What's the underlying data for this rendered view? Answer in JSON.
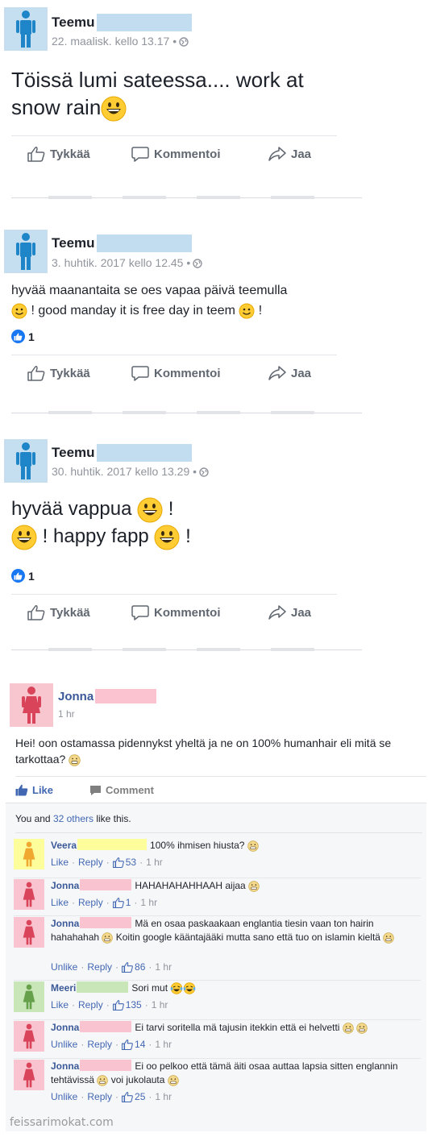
{
  "posts": [
    {
      "author": "Teemu",
      "meta": "22. maalisk. kello 13.17 •",
      "text_line1": "Töissä lumi sateessa.... work at",
      "text_line2": "snow rain",
      "reactions": "",
      "like_label": "Tykkää",
      "comment_label": "Kommentoi",
      "share_label": "Jaa"
    },
    {
      "author": "Teemu",
      "meta": "3. huhtik. 2017 kello 12.45 •",
      "text_line1": "hyvää maanantaita se oes vapaa päivä teemulla",
      "text_line2a": " ! good manday it is free day in teem ",
      "text_line2b": " !",
      "reactions": "1",
      "like_label": "Tykkää",
      "comment_label": "Kommentoi",
      "share_label": "Jaa"
    },
    {
      "author": "Teemu",
      "meta": "30. huhtik. 2017 kello 13.29 •",
      "text_line1a": "hyvää vappua ",
      "text_line1b": " !",
      "text_line2a": " ! happy fapp ",
      "text_line2b": " !",
      "reactions": "1",
      "like_label": "Tykkää",
      "comment_label": "Kommentoi",
      "share_label": "Jaa"
    }
  ],
  "jonna_post": {
    "author": "Jonna",
    "time": "1 hr",
    "text": "Hei! oon ostamassa pidennykst yheltä ja ne on 100% humanhair eli mitä se tarkottaa?",
    "like_label": "Like",
    "comment_label": "Comment",
    "likes_prefix": "You and ",
    "likes_link": "32 others",
    "likes_suffix": " like this."
  },
  "comments": [
    {
      "name": "Veera",
      "text": "100% ihmisen hiusta?",
      "like": "Like",
      "reply": "Reply",
      "count": "53",
      "time": "1 hr",
      "color": "#f0a830",
      "redact": "#fdfd9c"
    },
    {
      "name": "Jonna",
      "text": "HAHAHAHAHHAAH aijaa",
      "like": "Like",
      "reply": "Reply",
      "count": "1",
      "time": "1 hr",
      "color": "#d9445a",
      "redact": "#f9c4cf"
    },
    {
      "name": "Jonna",
      "text": "Mä en osaa paskaakaan englantia tiesin vaan ton hairin hahahahah",
      "text2": " Koitin google kääntajääki mutta sano että tuo on islamin kieltä",
      "like": "Unlike",
      "reply": "Reply",
      "count": "86",
      "time": "1 hr",
      "color": "#d9445a",
      "redact": "#f9c4cf"
    },
    {
      "name": "Meeri",
      "text": "Sori mut",
      "like": "Like",
      "reply": "Reply",
      "count": "135",
      "time": "1 hr",
      "color": "#66a04a",
      "redact": "#c8e6b8"
    },
    {
      "name": "Jonna",
      "text": "Ei tarvi soritella mä tajusin itekkin että ei helvetti",
      "like": "Unlike",
      "reply": "Reply",
      "count": "14",
      "time": "1 hr",
      "color": "#d9445a",
      "redact": "#f9c4cf"
    },
    {
      "name": "Jonna",
      "text": "Ei oo pelkoo että tämä äiti osaa auttaa lapsia sitten englannin tehtävissä",
      "text2": " voi jukolauta",
      "like": "Unlike",
      "reply": "Reply",
      "count": "25",
      "time": "1 hr",
      "color": "#d9445a",
      "redact": "#f9c4cf"
    }
  ],
  "watermark": "feissarimokat.com",
  "colors": {
    "fb_blue": "#1877f2",
    "link": "#3b5998",
    "teemu_redact": "#c2ddf0",
    "jonna_redact": "#fbc3d0"
  }
}
